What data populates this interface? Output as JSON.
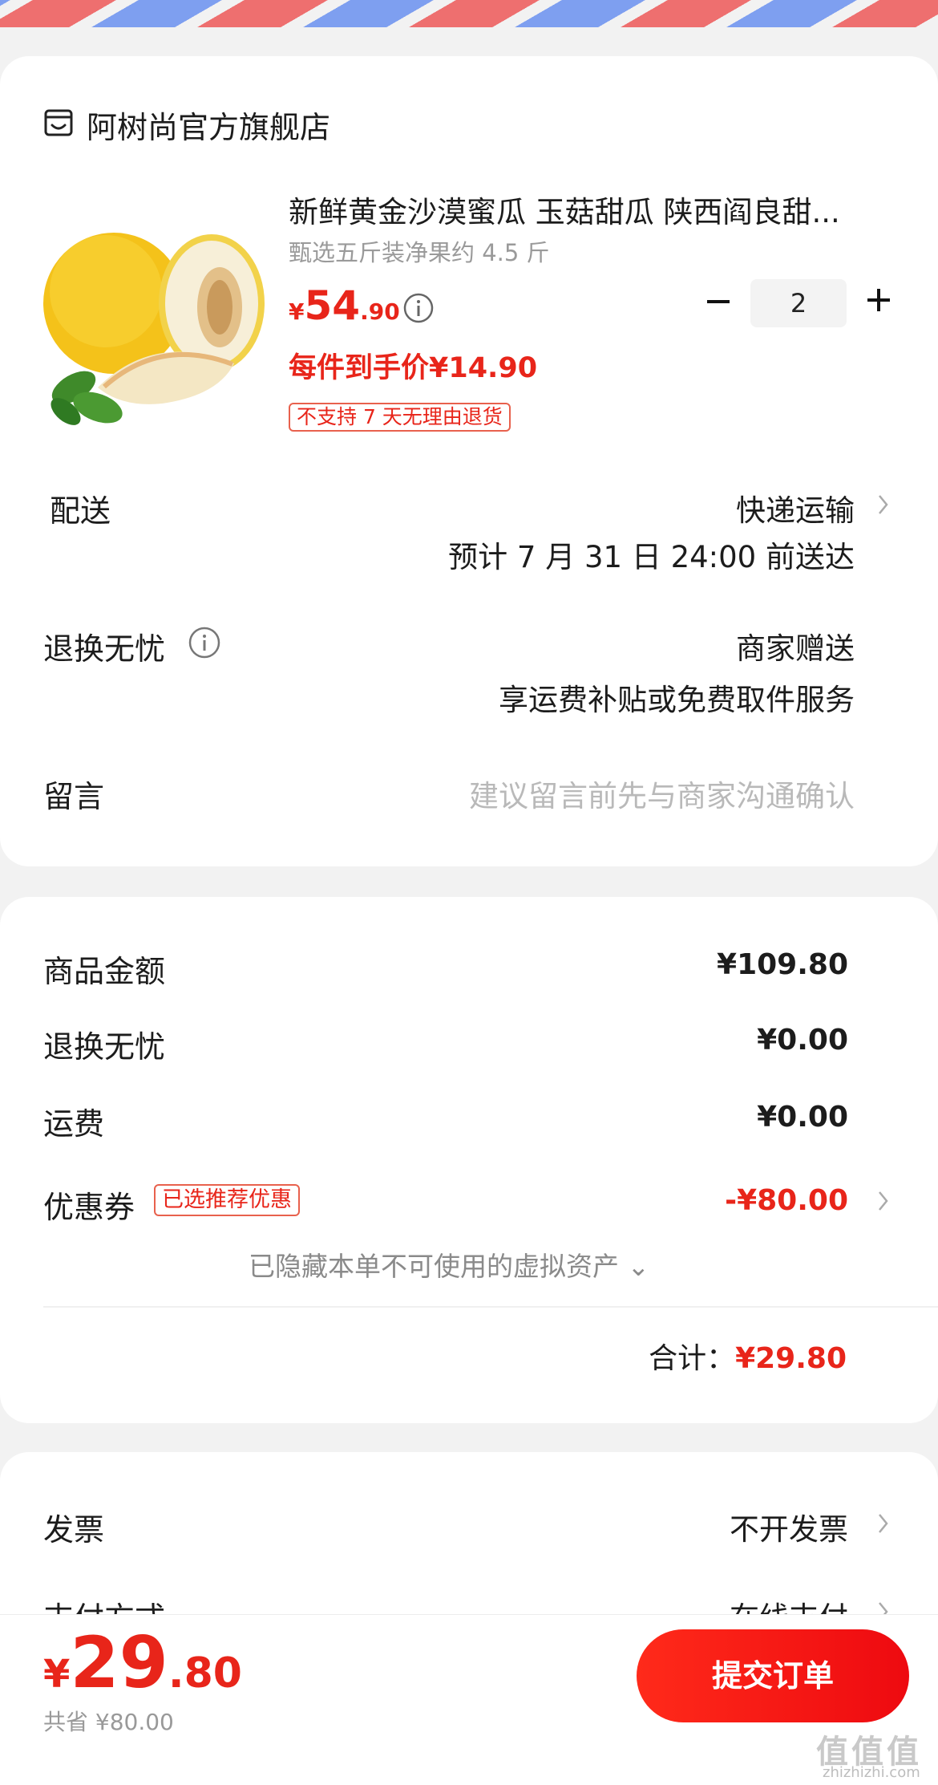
{
  "store": {
    "name": "阿树尚官方旗舰店",
    "icon": "store-icon"
  },
  "product": {
    "title": "新鲜黄金沙漠蜜瓜 玉菇甜瓜 陕西阎良甜...",
    "spec": "甄选五斤装净果约 4.5 斤",
    "price_symbol": "¥",
    "price_int": "54",
    "price_dec": ".90",
    "per_item_price": "每件到手价¥14.90",
    "return_tag": "不支持 7 天无理由退货",
    "quantity": "2"
  },
  "delivery": {
    "label": "配送",
    "method": "快递运输",
    "eta": "预计 7 月 31 日 24:00 前送达"
  },
  "return_service": {
    "label": "退换无忧",
    "value1": "商家赠送",
    "value2": "享运费补贴或免费取件服务"
  },
  "message": {
    "label": "留言",
    "placeholder": "建议留言前先与商家沟通确认"
  },
  "summary": {
    "goods_label": "商品金额",
    "goods_value": "¥109.80",
    "return_label": "退换无忧",
    "return_value": "¥0.00",
    "shipping_label": "运费",
    "shipping_value": "¥0.00",
    "coupon_label": "优惠券",
    "coupon_tag": "已选推荐优惠",
    "coupon_value": "-¥80.00",
    "hidden_assets": "已隐藏本单不可使用的虚拟资产 ⌄",
    "total_label": "合计：",
    "total_value": "¥29.80"
  },
  "invoice": {
    "label": "发票",
    "value": "不开发票"
  },
  "payment": {
    "label": "支付方式",
    "value": "在线支付"
  },
  "bottom": {
    "price_symbol": "¥",
    "price_int": "29",
    "price_dec": ".80",
    "saved": "共省 ¥80.00",
    "submit_label": "提交订单"
  },
  "watermark": {
    "main": "值值值",
    "sub": "zhizhizhi.com"
  },
  "colors": {
    "accent": "#e8251a",
    "button": "#ff2a1a"
  }
}
